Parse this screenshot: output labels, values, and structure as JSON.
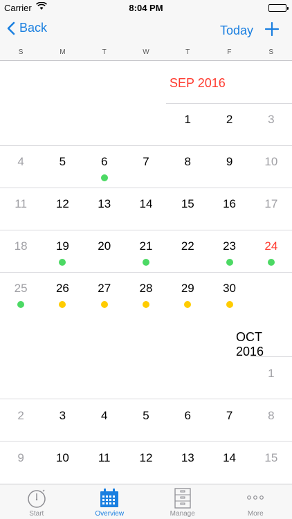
{
  "status_bar": {
    "carrier": "Carrier",
    "time": "8:04 PM"
  },
  "nav": {
    "back_label": "Back",
    "today_label": "Today"
  },
  "weekdays": [
    "S",
    "M",
    "T",
    "W",
    "T",
    "F",
    "S"
  ],
  "months": [
    {
      "label": "SEP 2016",
      "highlight_color": "#ff3b30"
    },
    {
      "label": "OCT 2016"
    }
  ],
  "sep_weeks": [
    [
      null,
      null,
      null,
      null,
      "1",
      "2",
      "3"
    ],
    [
      "4",
      "5",
      "6",
      "7",
      "8",
      "9",
      "10"
    ],
    [
      "11",
      "12",
      "13",
      "14",
      "15",
      "16",
      "17"
    ],
    [
      "18",
      "19",
      "20",
      "21",
      "22",
      "23",
      "24"
    ],
    [
      "25",
      "26",
      "27",
      "28",
      "29",
      "30",
      null
    ]
  ],
  "oct_weeks": [
    [
      null,
      null,
      null,
      null,
      null,
      null,
      "1"
    ],
    [
      "2",
      "3",
      "4",
      "5",
      "6",
      "7",
      "8"
    ],
    [
      "9",
      "10",
      "11",
      "12",
      "13",
      "14",
      "15"
    ]
  ],
  "today_date": "24",
  "event_markers": {
    "green": [
      "6",
      "19",
      "21",
      "23",
      "24",
      "25"
    ],
    "yellow": [
      "26",
      "27",
      "28",
      "29",
      "30"
    ]
  },
  "colors": {
    "accent": "#1a7fe0",
    "today": "#ff3b30",
    "marker_green": "#4cd964",
    "marker_yellow": "#ffcc00"
  },
  "tabs": [
    {
      "label": "Start",
      "icon": "stopwatch-icon",
      "active": false
    },
    {
      "label": "Overview",
      "icon": "calendar-icon",
      "active": true
    },
    {
      "label": "Manage",
      "icon": "file-cabinet-icon",
      "active": false
    },
    {
      "label": "More",
      "icon": "more-dots-icon",
      "active": false
    }
  ]
}
